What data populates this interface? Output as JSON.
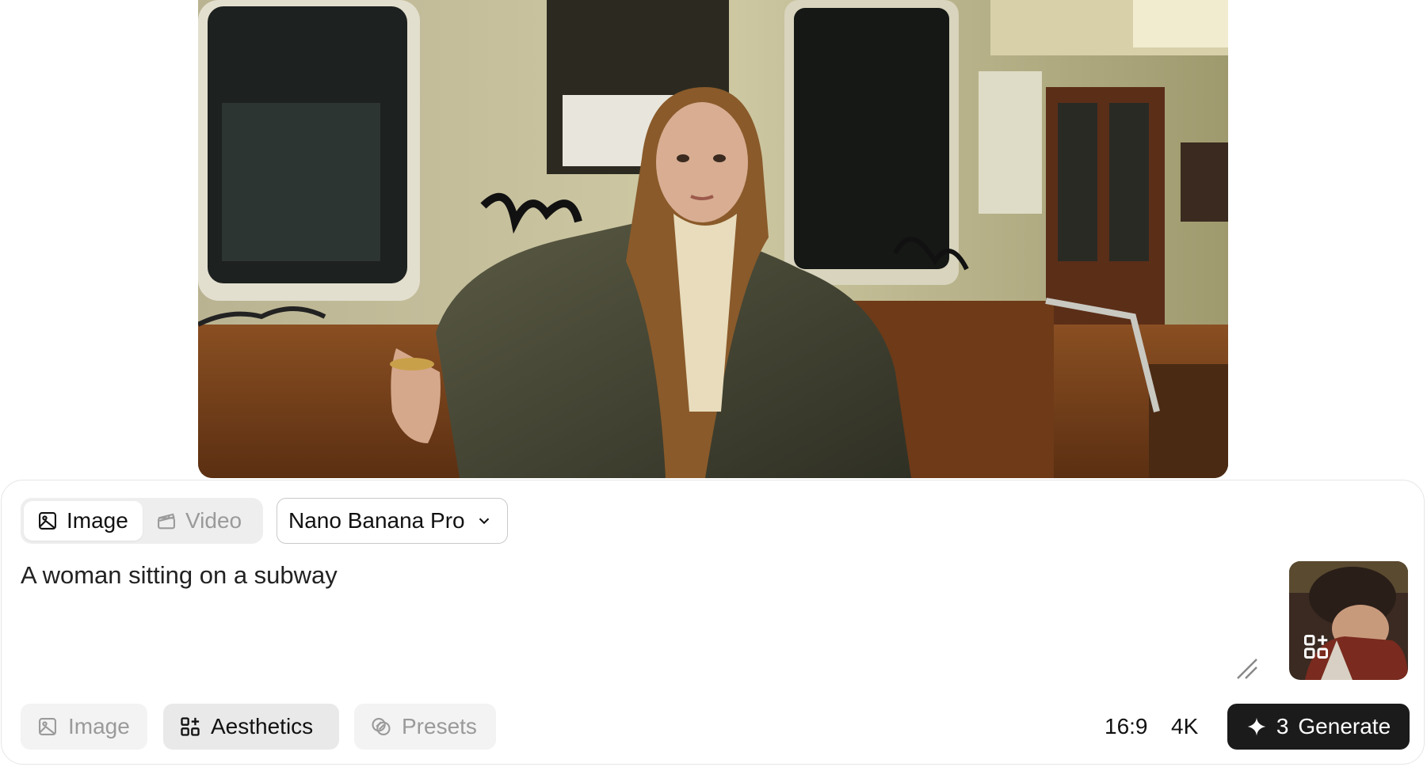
{
  "mode_toggle": {
    "image_label": "Image",
    "video_label": "Video",
    "active": "Image"
  },
  "model_select": {
    "value": "Nano Banana Pro"
  },
  "prompt": {
    "value": "A woman sitting on a subway"
  },
  "reference_image": {
    "icon": "aesthetics-grid-icon"
  },
  "chips": {
    "image_label": "Image",
    "aesthetics_label": "Aesthetics",
    "presets_label": "Presets",
    "active": "Aesthetics"
  },
  "options": {
    "aspect_ratio": "16:9",
    "resolution": "4K"
  },
  "generate": {
    "count": "3",
    "label": "Generate"
  },
  "colors": {
    "accent_dark": "#1b1b1b",
    "inactive_text": "#9a9a9a",
    "chip_bg": "#f3f3f3"
  }
}
